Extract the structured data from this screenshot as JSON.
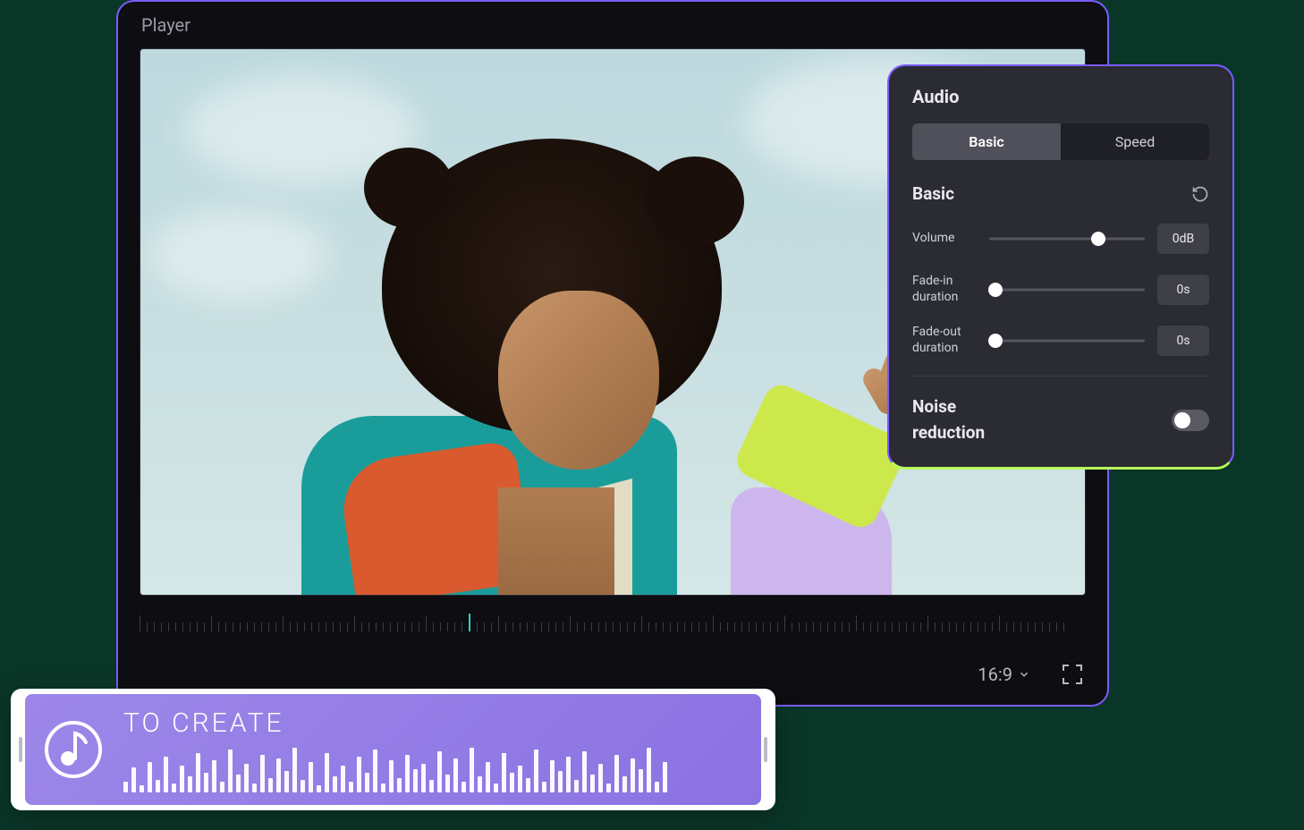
{
  "player": {
    "title": "Player",
    "aspect_ratio": "16:9"
  },
  "audio_panel": {
    "title": "Audio",
    "tabs": {
      "basic": "Basic",
      "speed": "Speed"
    },
    "section_title": "Basic",
    "controls": {
      "volume": {
        "label": "Volume",
        "value": "0dB",
        "position": 0.7
      },
      "fade_in": {
        "label": "Fade-in duration",
        "value": "0s",
        "position": 0.04
      },
      "fade_out": {
        "label": "Fade-out duration",
        "value": "0s",
        "position": 0.04
      }
    },
    "noise_reduction_label": "Noise reduction",
    "noise_reduction_on": false
  },
  "clip": {
    "label": "TO CREATE"
  },
  "colors": {
    "accent_purple": "#7a5cff",
    "accent_lime": "#b8ff5c",
    "panel_bg": "#2b2b33"
  }
}
